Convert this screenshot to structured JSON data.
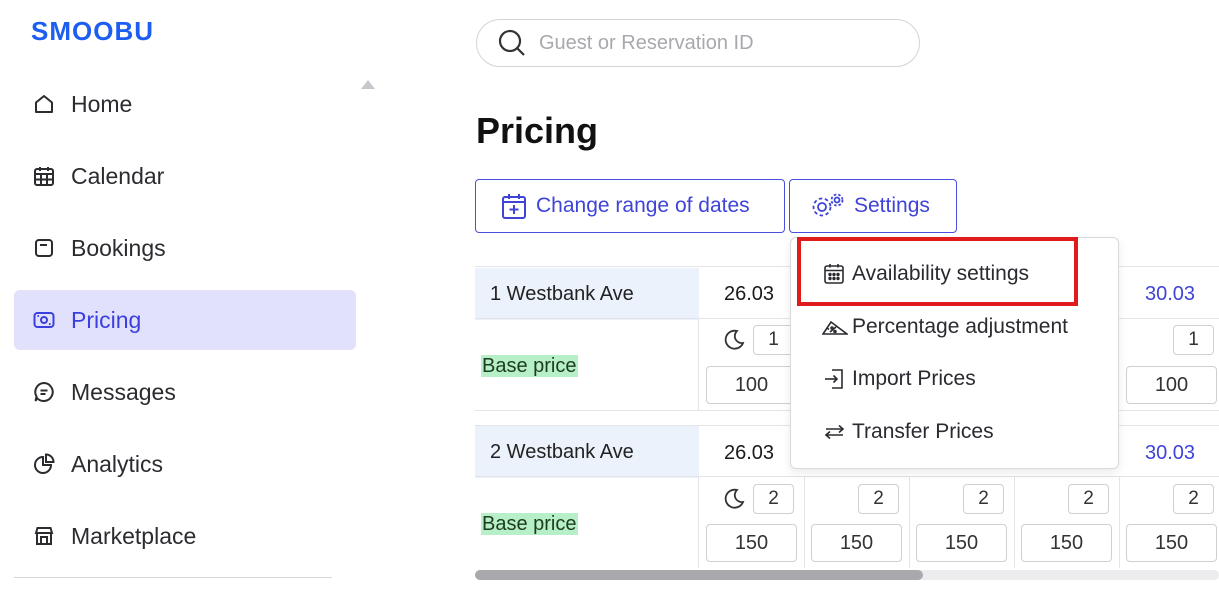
{
  "app": {
    "logo": "SMOOBU"
  },
  "sidebar": {
    "items": [
      {
        "label": "Home",
        "icon": "home-icon",
        "active": false
      },
      {
        "label": "Calendar",
        "icon": "calendar-icon",
        "active": false
      },
      {
        "label": "Bookings",
        "icon": "bookings-icon",
        "active": false
      },
      {
        "label": "Pricing",
        "icon": "pricing-icon",
        "active": true
      },
      {
        "label": "Messages",
        "icon": "messages-icon",
        "active": false
      },
      {
        "label": "Analytics",
        "icon": "analytics-icon",
        "active": false
      },
      {
        "label": "Marketplace",
        "icon": "marketplace-icon",
        "active": false
      }
    ]
  },
  "search": {
    "placeholder": "Guest or Reservation ID",
    "value": ""
  },
  "page": {
    "title": "Pricing"
  },
  "toolbar": {
    "change_range_label": "Change range of dates",
    "settings_label": "Settings"
  },
  "settings_menu": {
    "items": [
      {
        "label": "Availability settings",
        "icon": "calendar-grid-icon",
        "highlighted": true
      },
      {
        "label": "Percentage adjustment",
        "icon": "ruler-percent-icon"
      },
      {
        "label": "Import Prices",
        "icon": "import-icon"
      },
      {
        "label": "Transfer Prices",
        "icon": "transfer-icon"
      }
    ]
  },
  "table": {
    "properties": [
      {
        "name": "2 Westbank Ave",
        "dates": [
          "26.03",
          "30.03"
        ],
        "base_label": "Base price",
        "min_stay": [
          "2",
          "2",
          "2",
          "2",
          "2"
        ],
        "prices": [
          "150",
          "150",
          "150",
          "150",
          "150"
        ]
      },
      {
        "name": "1 Westbank Ave",
        "dates": [
          "26.03",
          "30.03"
        ],
        "base_label": "Base price",
        "min_stay": [
          "1",
          "1"
        ],
        "prices": [
          "100",
          "100"
        ]
      }
    ]
  },
  "colors": {
    "accent": "#3f43d8",
    "brand": "#1d5ef2",
    "active_bg": "#e1e1fb",
    "highlight": "#e01b1b",
    "base_price_bg": "#b7efc8"
  }
}
